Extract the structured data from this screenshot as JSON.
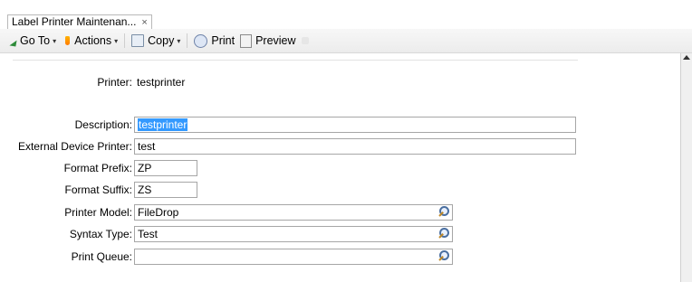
{
  "tab": {
    "title": "Label Printer Maintenan...",
    "close": "×"
  },
  "toolbar": {
    "goto_label": "Go To",
    "actions_label": "Actions",
    "copy_label": "Copy",
    "print_label": "Print",
    "preview_label": "Preview",
    "caret": "▾"
  },
  "form": {
    "printer_label": "Printer:",
    "printer_value": "testprinter",
    "description_label": "Description:",
    "description_value": "testprinter",
    "external_label": "External Device Printer:",
    "external_value": "test",
    "prefix_label": "Format Prefix:",
    "prefix_value": "ZP",
    "suffix_label": "Format Suffix:",
    "suffix_value": "ZS",
    "model_label": "Printer Model:",
    "model_value": "FileDrop",
    "syntax_label": "Syntax Type:",
    "syntax_value": "Test",
    "queue_label": "Print Queue:",
    "queue_value": ""
  }
}
